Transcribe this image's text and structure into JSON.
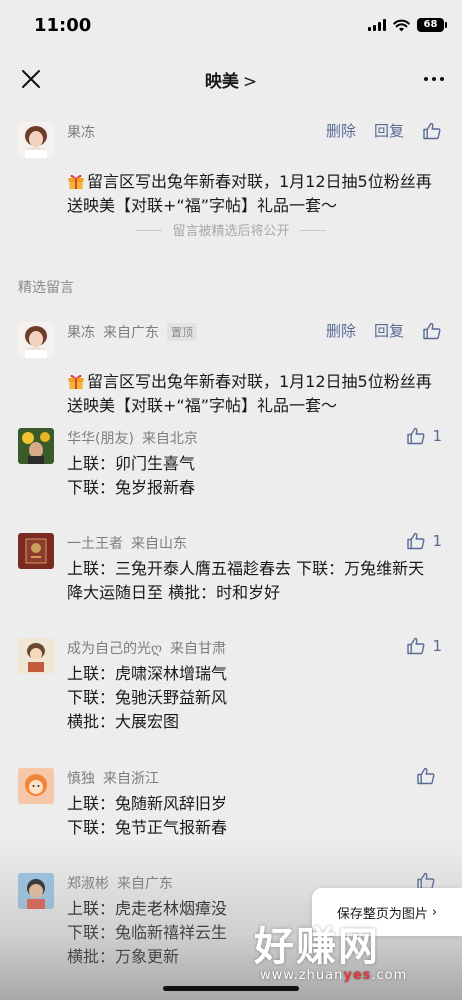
{
  "status_bar": {
    "time": "11:00",
    "battery": "68"
  },
  "nav": {
    "title": "映美",
    "chevron": ">"
  },
  "top_comment": {
    "author": "果冻",
    "delete_label": "删除",
    "reply_label": "回复",
    "text": "留言区写出兔年新春对联，1月12日抽5位粉丝再送映美【对联+“福”字帖】礼品一套～"
  },
  "pending_note": "留言被精选后将公开",
  "featured_label": "精选留言",
  "featured": {
    "author": "果冻",
    "location": "来自广东",
    "pin_label": "置顶",
    "delete_label": "删除",
    "reply_label": "回复",
    "text": "留言区写出兔年新春对联，1月12日抽5位粉丝再送映美【对联+“福”字帖】礼品一套～"
  },
  "comments": [
    {
      "author": "华华(朋友)",
      "location": "来自北京",
      "likes": "1",
      "text": "上联：卯门生喜气\n下联：兔岁报新春"
    },
    {
      "author": "一土王者",
      "location": "来自山东",
      "likes": "1",
      "text": "上联：三兔开泰人膺五福趁春去 下联：万兔维新天降大运随日至 横批：时和岁好"
    },
    {
      "author": "成为自己的光ღ",
      "location": "来自甘肃",
      "likes": "1",
      "text": "上联：虎啸深林增瑞气\n下联：兔驰沃野益新风\n横批：大展宏图"
    },
    {
      "author": "慎独",
      "location": "来自浙江",
      "likes": "",
      "text": "上联：兔随新风辞旧岁\n下联：兔节正气报新春"
    },
    {
      "author": "郑淑彬",
      "location": "来自广东",
      "likes": "",
      "text": "上联：虎走老林烟瘴没\n下联：兔临新禧祥云生\n横批：万象更新"
    }
  ],
  "save_image_label": "保存整页为图片",
  "watermark": {
    "main": "好赚网",
    "site_prefix": "www.zhuan",
    "site_highlight": "yes",
    "site_suffix": ".com"
  },
  "colors": {
    "link": "#576b95",
    "background": "#ededed"
  }
}
